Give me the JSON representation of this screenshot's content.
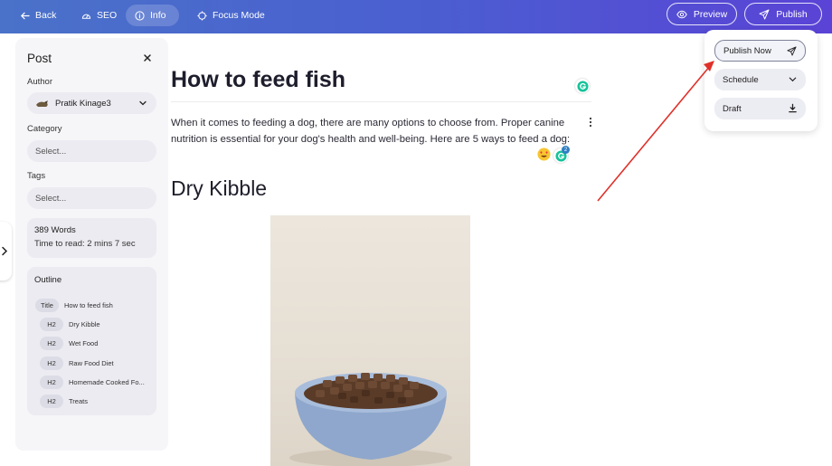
{
  "toolbar": {
    "back": "Back",
    "seo": "SEO",
    "info": "Info",
    "focus_mode": "Focus Mode",
    "preview": "Preview",
    "publish": "Publish"
  },
  "sidebar": {
    "title": "Post",
    "author_label": "Author",
    "author_value": "Pratik Kinage3",
    "category_label": "Category",
    "category_placeholder": "Select...",
    "tags_label": "Tags",
    "tags_placeholder": "Select...",
    "words": "389 Words",
    "read_time": "Time to read: 2 mins 7 sec",
    "outline_title": "Outline",
    "outline": [
      {
        "tag": "Title",
        "text": "How to feed fish"
      },
      {
        "tag": "H2",
        "text": "Dry Kibble"
      },
      {
        "tag": "H2",
        "text": "Wet Food"
      },
      {
        "tag": "H2",
        "text": "Raw Food Diet"
      },
      {
        "tag": "H2",
        "text": "Homemade Cooked Fo..."
      },
      {
        "tag": "H2",
        "text": "Treats"
      }
    ]
  },
  "editor": {
    "title": "How to feed fish",
    "paragraph": "When it comes to feeding a dog, there are many options to choose from. Proper canine nutrition is essential for your dog's health and well-being. Here are 5 ways to feed a dog:",
    "grammarly_count": "2",
    "heading": "Dry Kibble"
  },
  "publish_menu": {
    "publish_now": "Publish Now",
    "schedule": "Schedule",
    "draft": "Draft"
  },
  "colors": {
    "toolbar_start": "#4a72c9",
    "toolbar_end": "#5a43d6",
    "annotation_arrow": "#e0302a",
    "grammarly": "#15c39a"
  }
}
